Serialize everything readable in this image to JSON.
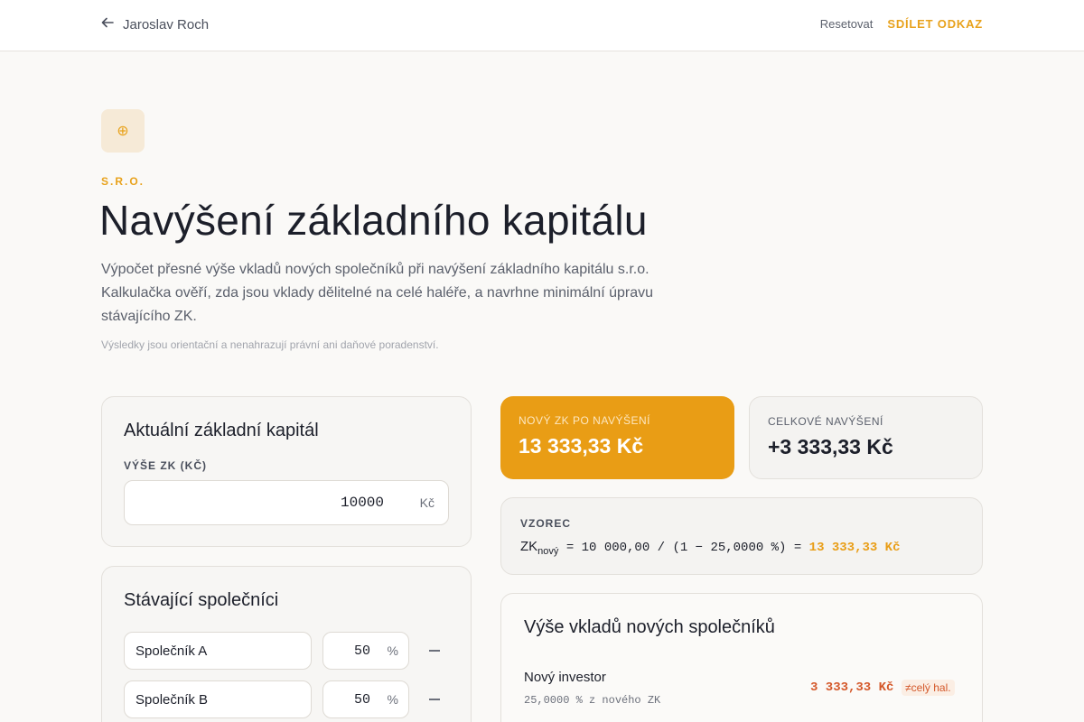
{
  "topbar": {
    "back_label": "Jaroslav Roch",
    "reset_label": "Resetovat",
    "share_label": "SDÍLET ODKAZ"
  },
  "hero": {
    "icon": "⊕",
    "eyebrow": "S.R.O.",
    "title": "Navýšení základního kapitálu",
    "lead": "Výpočet přesné výše vkladů nových společníků při navýšení základního kapitálu s.r.o. Kalkulačka ověří, zda jsou vklady dělitelné na celé haléře, a navrhne minimální úpravu stávajícího ZK.",
    "disclaimer": "Výsledky jsou orientační a nenahrazují právní ani daňové poradenství."
  },
  "capital_card": {
    "title": "Aktuální základní kapitál",
    "field_label": "VÝŠE ZK (KČ)",
    "value": "10000",
    "unit": "Kč"
  },
  "partners_card": {
    "title": "Stávající společníci",
    "rows": [
      {
        "name": "Společník A",
        "percent": "50",
        "unit": "%"
      },
      {
        "name": "Společník B",
        "percent": "50",
        "unit": "%"
      }
    ]
  },
  "summary": {
    "new_zk_label": "NOVÝ ZK PO NAVÝŠENÍ",
    "new_zk_value": "13 333,33 Kč",
    "total_increase_label": "CELKOVÉ NAVÝŠENÍ",
    "total_increase_value": "+3 333,33 Kč"
  },
  "formula": {
    "label": "VZOREC",
    "lhs": "ZK",
    "lhs_sub": "nový",
    "expression": " = 10 000,00 / (1 − 25,0000 %) = ",
    "result": "13 333,33 Kč"
  },
  "contributions": {
    "title": "Výše vkladů nových společníků",
    "items": [
      {
        "name": "Nový investor",
        "share_text": "25,0000 % z nového ZK",
        "amount": "3 333,33 Kč",
        "warning": "≠celý hal."
      }
    ]
  },
  "colors": {
    "accent": "#e99d15",
    "warning": "#d4582a",
    "warning_bg": "#fbeee4"
  }
}
